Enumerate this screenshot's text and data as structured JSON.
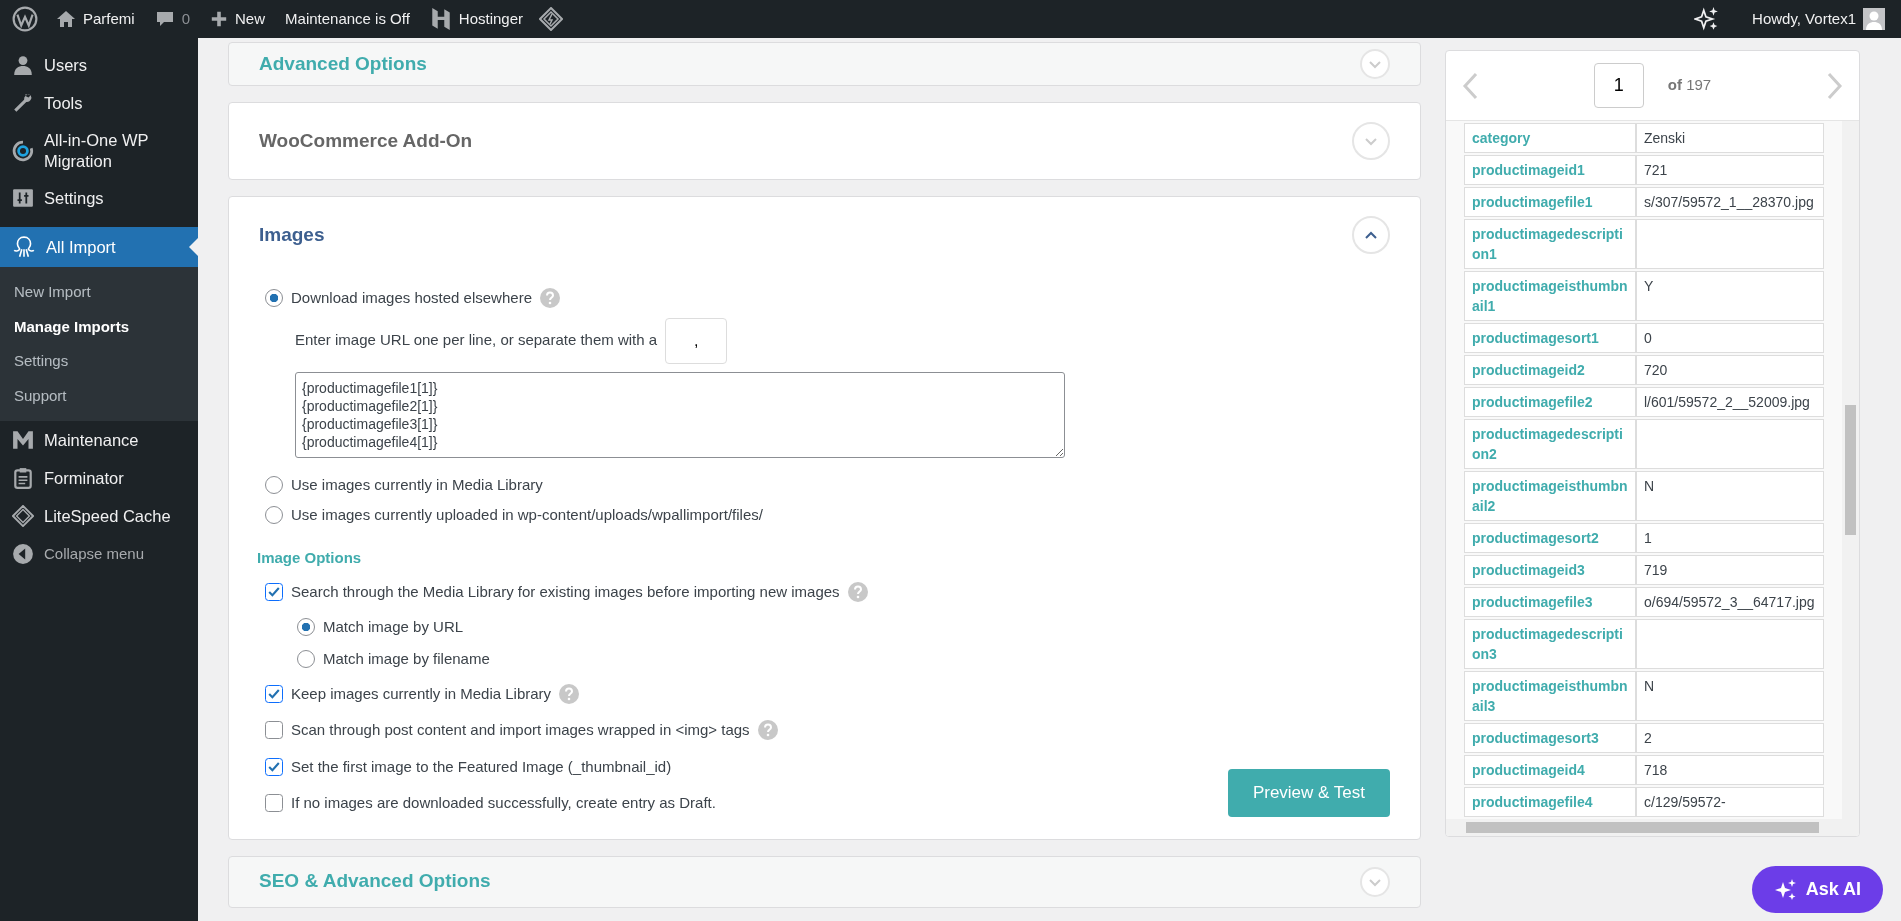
{
  "admin_bar": {
    "items": [
      {
        "kind": "site",
        "label": "Parfemi"
      },
      {
        "kind": "comments",
        "label": "0"
      },
      {
        "kind": "new",
        "label": "New"
      },
      {
        "kind": "text",
        "label": "Maintenance is Off"
      },
      {
        "kind": "hosting",
        "label": "Hostinger"
      }
    ],
    "account": "Howdy, Vortex1"
  },
  "sidebar": {
    "items": [
      {
        "label": "Users",
        "selected": false
      },
      {
        "label": "Tools",
        "selected": false
      },
      {
        "label": "All-in-One WP Migration",
        "selected": false
      },
      {
        "label": "Settings",
        "selected": false
      },
      {
        "label": "All Import",
        "selected": true,
        "children": [
          {
            "label": "New Import",
            "selected": false
          },
          {
            "label": "Manage Imports",
            "selected": true
          },
          {
            "label": "Settings",
            "selected": false
          },
          {
            "label": "Support",
            "selected": false
          }
        ]
      },
      {
        "label": "Maintenance",
        "selected": false
      },
      {
        "label": "Forminator",
        "selected": false
      },
      {
        "label": "LiteSpeed Cache",
        "selected": false
      }
    ],
    "collapse": "Collapse menu"
  },
  "sections": [
    {
      "title": "Advanced Options",
      "expanded": false,
      "color": "#40acad"
    },
    {
      "title": "WooCommerce Add-On",
      "expanded": false,
      "color": "#666666"
    },
    {
      "title": "Images",
      "expanded": true,
      "color": "#3d5f8f"
    },
    {
      "title": "SEO & Advanced Options",
      "expanded": false,
      "color": "#40acad"
    }
  ],
  "images": {
    "sources": [
      {
        "label": "Download images hosted elsewhere",
        "selected": true,
        "help": true
      },
      {
        "label": "Use images currently in Media Library",
        "selected": false,
        "help": false
      },
      {
        "label": "Use images currently uploaded in wp-content/uploads/wpallimport/files/",
        "selected": false,
        "help": false
      }
    ],
    "separator": {
      "label": "Enter image URL one per line, or separate them with a",
      "value": ","
    },
    "urls": "{productimagefile1[1]}\n{productimagefile2[1]}\n{productimagefile3[1]}\n{productimagefile4[1]}",
    "options_title": "Image Options",
    "options": [
      {
        "label": "Search through the Media Library for existing images before importing new images",
        "checked": true,
        "help": true,
        "children": [
          {
            "label": "Match image by URL",
            "selected": true
          },
          {
            "label": "Match image by filename",
            "selected": false
          }
        ]
      },
      {
        "label": "Keep images currently in Media Library",
        "checked": true,
        "help": true
      },
      {
        "label": "Scan through post content and import images wrapped in <img> tags",
        "checked": false,
        "help": true
      },
      {
        "label": "Set the first image to the Featured Image (_thumbnail_id)",
        "checked": true,
        "help": false
      },
      {
        "label": "If no images are downloaded successfully, create entry as Draft.",
        "checked": false,
        "help": false
      }
    ],
    "button": "Preview & Test"
  },
  "record": {
    "page": "1",
    "of": "**of** 197",
    "rows": [
      {
        "key": "category",
        "value": "Zenski"
      },
      {
        "key": "productimageid1",
        "value": "721"
      },
      {
        "key": "productimagefile1",
        "value": "s/307/59572_1__28370.jpg"
      },
      {
        "key": "productimagedescription1",
        "value": ""
      },
      {
        "key": "productimageisthumbnail1",
        "value": "Y"
      },
      {
        "key": "productimagesort1",
        "value": "0"
      },
      {
        "key": "productimageid2",
        "value": "720"
      },
      {
        "key": "productimagefile2",
        "value": "l/601/59572_2__52009.jpg"
      },
      {
        "key": "productimagedescription2",
        "value": ""
      },
      {
        "key": "productimageisthumbnail2",
        "value": "N"
      },
      {
        "key": "productimagesort2",
        "value": "1"
      },
      {
        "key": "productimageid3",
        "value": "719"
      },
      {
        "key": "productimagefile3",
        "value": "o/694/59572_3__64717.jpg"
      },
      {
        "key": "productimagedescription3",
        "value": ""
      },
      {
        "key": "productimageisthumbnail3",
        "value": "N"
      },
      {
        "key": "productimagesort3",
        "value": "2"
      },
      {
        "key": "productimageid4",
        "value": "718"
      },
      {
        "key": "productimagefile4",
        "value": "c/129/59572-"
      }
    ]
  },
  "ask_ai": "Ask AI"
}
